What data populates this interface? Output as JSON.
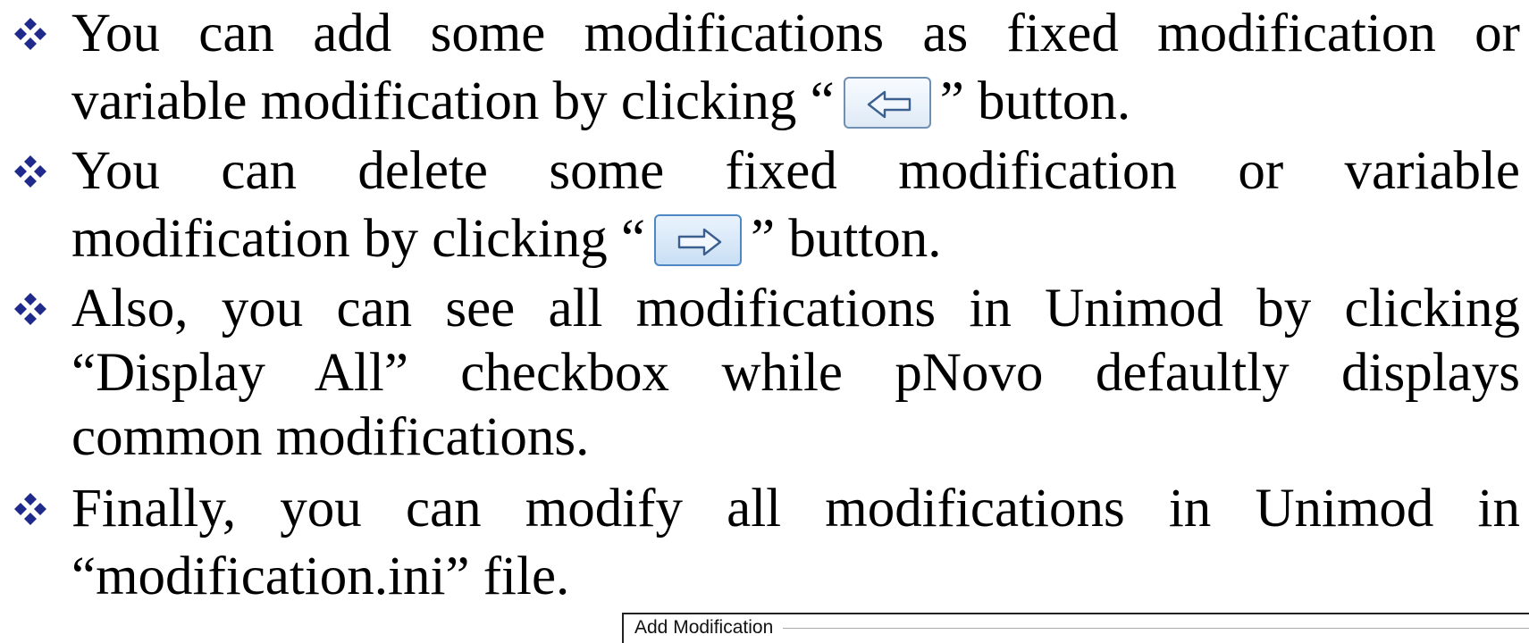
{
  "bullets": [
    {
      "lines": [
        {
          "text": "You can add some modifications as fixed modification or"
        },
        {
          "before": "variable modification by clicking “",
          "after": "” button.",
          "button_icon": "arrow-left-icon"
        }
      ]
    },
    {
      "lines": [
        {
          "text": "You can delete some fixed modification or variable"
        },
        {
          "before": "modification by clicking “",
          "after": "” button.",
          "button_icon": "arrow-right-icon"
        }
      ]
    },
    {
      "lines": [
        {
          "text": "Also, you can see all modifications in Unimod by clicking"
        },
        {
          "text": "“Display All” checkbox while pNovo defaultly displays"
        },
        {
          "text": "common modifications."
        }
      ]
    },
    {
      "lines": [
        {
          "text": "Finally, you can modify all modifications in Unimod in"
        },
        {
          "text": "“modification.ini” file."
        }
      ]
    }
  ],
  "bullet_icon": "four-diamond-bullet-icon",
  "bullet_color": "#1f2a8c",
  "dialog": {
    "title": "Add Modification"
  }
}
